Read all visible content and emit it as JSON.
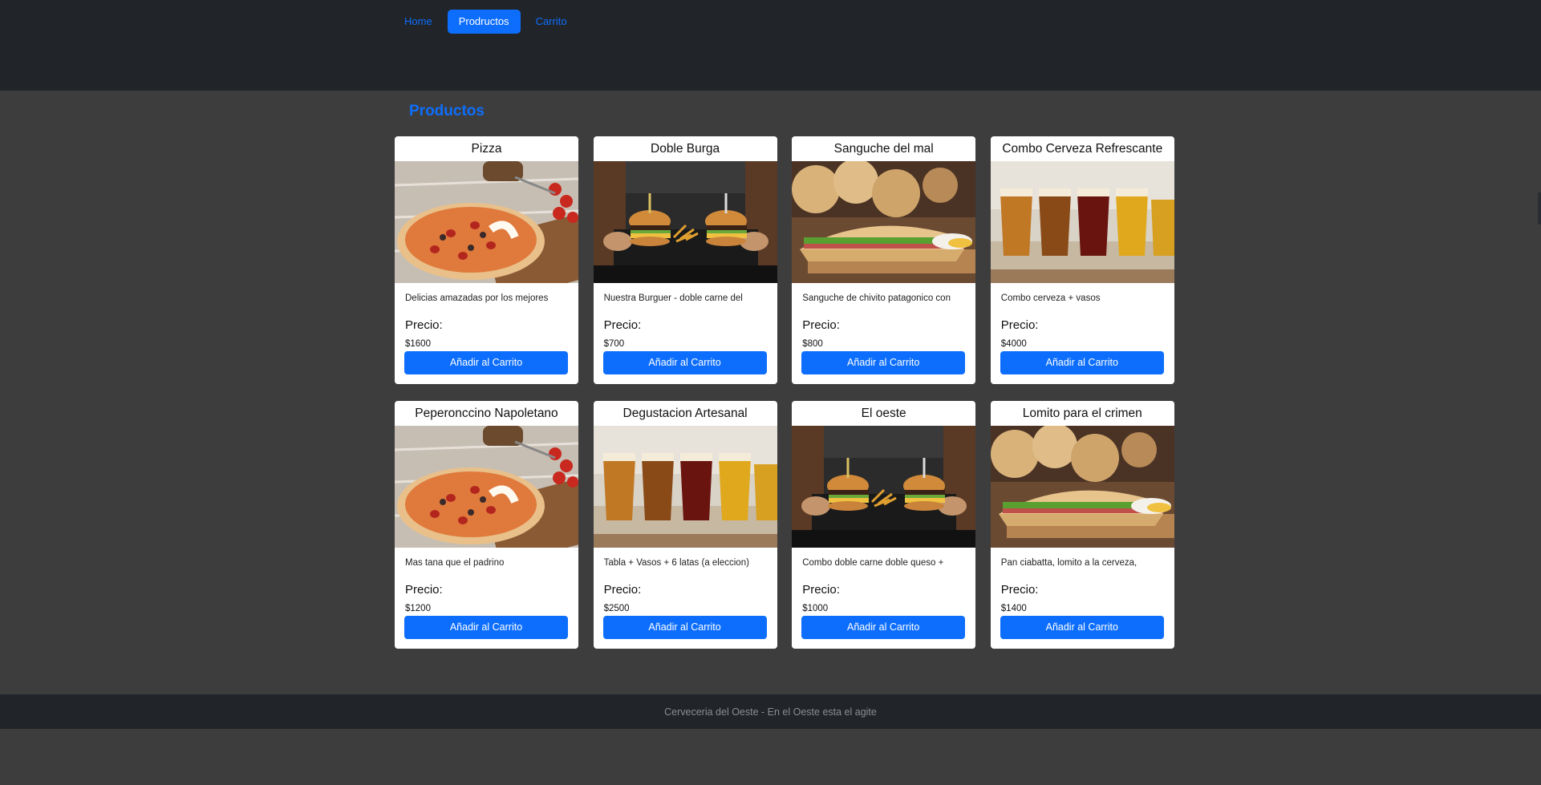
{
  "nav": {
    "items": [
      {
        "label": "Home",
        "active": false
      },
      {
        "label": "Prodructos",
        "active": true
      },
      {
        "label": "Carrito",
        "active": false
      }
    ]
  },
  "page": {
    "title": "Productos"
  },
  "colors": {
    "accent": "#0d6efd",
    "navbar": "#212529",
    "background": "#3d3d3d"
  },
  "products": [
    {
      "name": "Pizza",
      "image": "pizza-image",
      "description": "Delicias amazadas por los mejores",
      "price_label": "Precio:",
      "price": "$1600",
      "button": "Añadir al Carrito"
    },
    {
      "name": "Doble Burga",
      "image": "burger-image",
      "description": "Nuestra Burguer - doble carne del",
      "price_label": "Precio:",
      "price": "$700",
      "button": "Añadir al Carrito"
    },
    {
      "name": "Sanguche del mal",
      "image": "sandwich-image",
      "description": "Sanguche de chivito patagonico con",
      "price_label": "Precio:",
      "price": "$800",
      "button": "Añadir al Carrito"
    },
    {
      "name": "Combo Cerveza Refrescante",
      "image": "beer-image",
      "description": "Combo cerveza + vasos",
      "price_label": "Precio:",
      "price": "$4000",
      "button": "Añadir al Carrito"
    },
    {
      "name": "Peperonccino Napoletano",
      "image": "pizza-image",
      "description": "Mas tana que el padrino",
      "price_label": "Precio:",
      "price": "$1200",
      "button": "Añadir al Carrito"
    },
    {
      "name": "Degustacion Artesanal",
      "image": "beer-image",
      "description": "Tabla + Vasos + 6 latas (a eleccion)",
      "price_label": "Precio:",
      "price": "$2500",
      "button": "Añadir al Carrito"
    },
    {
      "name": "El oeste",
      "image": "burger-image",
      "description": "Combo doble carne doble queso +",
      "price_label": "Precio:",
      "price": "$1000",
      "button": "Añadir al Carrito"
    },
    {
      "name": "Lomito para el crimen",
      "image": "sandwich-image",
      "description": "Pan ciabatta, lomito a la cerveza,",
      "price_label": "Precio:",
      "price": "$1400",
      "button": "Añadir al Carrito"
    }
  ],
  "footer": {
    "text": "Cerveceria del Oeste - En el Oeste esta el agite"
  }
}
